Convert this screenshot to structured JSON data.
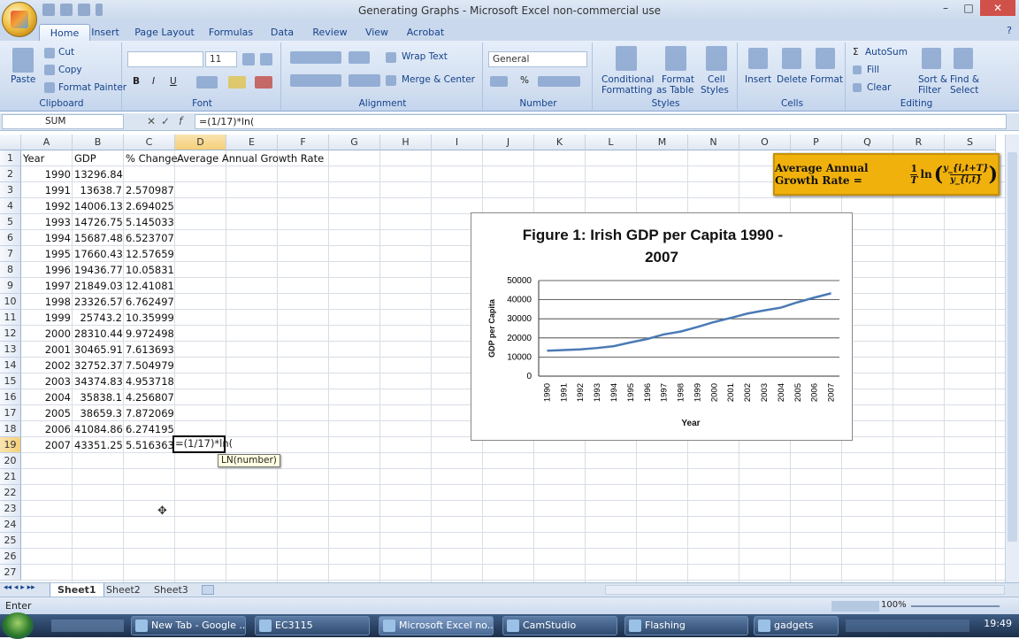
{
  "window": {
    "title": "Generating Graphs - Microsoft Excel non-commercial use",
    "controls": [
      "–",
      "□",
      "✕"
    ]
  },
  "ribbon_tabs": [
    "Home",
    "Insert",
    "Page Layout",
    "Formulas",
    "Data",
    "Review",
    "View",
    "Acrobat"
  ],
  "ribbon": {
    "clipboard": {
      "label": "Clipboard",
      "paste": "Paste",
      "cut": "Cut",
      "copy": "Copy",
      "format_painter": "Format Painter"
    },
    "font": {
      "label": "Font",
      "name": "",
      "size": "11",
      "bold": "B",
      "italic": "I",
      "underline": "U"
    },
    "alignment": {
      "label": "Alignment",
      "wrap": "Wrap Text",
      "merge": "Merge & Center"
    },
    "number": {
      "label": "Number",
      "format": "General",
      "percent": "%"
    },
    "styles": {
      "label": "Styles",
      "conditional": "Conditional",
      "conditional2": "Formatting",
      "format_table": "Format",
      "format_table2": "as Table",
      "cell_styles": "Cell",
      "cell_styles2": "Styles"
    },
    "cells": {
      "label": "Cells",
      "insert": "Insert",
      "delete": "Delete",
      "format": "Format"
    },
    "editing": {
      "label": "Editing",
      "autosum": "AutoSum",
      "fill": "Fill",
      "clear": "Clear",
      "sort": "Sort &",
      "sort2": "Filter",
      "find": "Find &",
      "find2": "Select"
    }
  },
  "formula_bar": {
    "name_box": "SUM",
    "content": "=(1/17)*ln("
  },
  "columns": [
    "A",
    "B",
    "C",
    "D",
    "E",
    "F",
    "G",
    "H",
    "I",
    "J",
    "K",
    "L",
    "M",
    "N",
    "O",
    "P",
    "Q",
    "R",
    "S"
  ],
  "rows": [
    "1",
    "2",
    "3",
    "4",
    "5",
    "6",
    "7",
    "8",
    "9",
    "10",
    "11",
    "12",
    "13",
    "14",
    "15",
    "16",
    "17",
    "18",
    "19",
    "20",
    "21",
    "22",
    "23",
    "24",
    "25",
    "26",
    "27"
  ],
  "headers": {
    "a": "Year",
    "b": "GDP",
    "c": "% Change",
    "d": "Average Annual Growth Rate"
  },
  "table": [
    [
      "1990",
      "13296.84",
      ""
    ],
    [
      "1991",
      "13638.7",
      "2.570987"
    ],
    [
      "1992",
      "14006.13",
      "2.694025"
    ],
    [
      "1993",
      "14726.75",
      "5.145033"
    ],
    [
      "1994",
      "15687.48",
      "6.523707"
    ],
    [
      "1995",
      "17660.43",
      "12.57659"
    ],
    [
      "1996",
      "19436.77",
      "10.05831"
    ],
    [
      "1997",
      "21849.03",
      "12.41081"
    ],
    [
      "1998",
      "23326.57",
      "6.762497"
    ],
    [
      "1999",
      "25743.2",
      "10.35999"
    ],
    [
      "2000",
      "28310.44",
      "9.972498"
    ],
    [
      "2001",
      "30465.91",
      "7.613693"
    ],
    [
      "2002",
      "32752.37",
      "7.504979"
    ],
    [
      "2003",
      "34374.83",
      "4.953718"
    ],
    [
      "2004",
      "35838.1",
      "4.256807"
    ],
    [
      "2005",
      "38659.3",
      "7.872069"
    ],
    [
      "2006",
      "41084.86",
      "6.274195"
    ],
    [
      "2007",
      "43351.25",
      "5.516363"
    ]
  ],
  "active_cell": {
    "content": "=(1/17)*ln(",
    "tooltip": "LN(number)"
  },
  "formula_image": {
    "lhs": "Average Annual Growth Rate =",
    "frac_num": "1",
    "frac_den": "T",
    "fn": "ln",
    "ratio_num": "y_{i,t+T}",
    "ratio_den": "y_{i,t}"
  },
  "chart_data": {
    "type": "line",
    "title": "Figure 1: Irish GDP per Capita 1990 - 2007",
    "xlabel": "Year",
    "ylabel": "GDP per Capita",
    "ylim": [
      0,
      50000
    ],
    "yticks": [
      "0",
      "10000",
      "20000",
      "30000",
      "40000",
      "50000"
    ],
    "x": [
      "1990",
      "1991",
      "1992",
      "1993",
      "1994",
      "1995",
      "1996",
      "1997",
      "1998",
      "1999",
      "2000",
      "2001",
      "2002",
      "2003",
      "2004",
      "2005",
      "2006",
      "2007"
    ],
    "series": [
      {
        "values": [
          13296.84,
          13638.7,
          14006.13,
          14726.75,
          15687.48,
          17660.43,
          19436.77,
          21849.03,
          23326.57,
          25743.2,
          28310.44,
          30465.91,
          32752.37,
          34374.83,
          35838.1,
          38659.3,
          41084.86,
          43351.25
        ],
        "color": "#4a7ab5"
      }
    ],
    "grid": true,
    "legend": "none"
  },
  "sheets": [
    "Sheet1",
    "Sheet2",
    "Sheet3"
  ],
  "status": {
    "mode": "Enter",
    "zoom": "100%"
  },
  "taskbar": {
    "items": [
      "New Tab - Google ...",
      "EC3115",
      "Microsoft Excel no...",
      "CamStudio",
      "Flashing",
      "gadgets"
    ],
    "clock": "19:49"
  }
}
